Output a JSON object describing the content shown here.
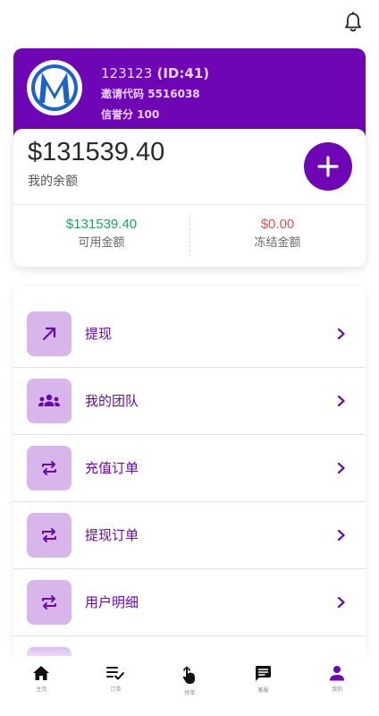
{
  "header": {
    "bell_icon": "bell-icon"
  },
  "profile": {
    "username": "123123",
    "id_text": "(ID:41)",
    "invite_label": "邀请代码",
    "invite_code": "5516038",
    "credit_label": "信誉分",
    "credit_score": "100",
    "avatar_letter": "M"
  },
  "balance": {
    "amount": "$131539.40",
    "label": "我的余额",
    "available_value": "$131539.40",
    "available_label": "可用金额",
    "frozen_value": "$0.00",
    "frozen_label": "冻结金额"
  },
  "menu": {
    "items": [
      {
        "label": "提现",
        "icon": "arrow-up-right-icon"
      },
      {
        "label": "我的团队",
        "icon": "team-icon"
      },
      {
        "label": "充值订单",
        "icon": "swap-icon"
      },
      {
        "label": "提现订单",
        "icon": "swap-icon"
      },
      {
        "label": "用户明细",
        "icon": "swap-icon"
      }
    ]
  },
  "nav": {
    "items": [
      {
        "label": "主页",
        "icon": "home-icon"
      },
      {
        "label": "订单",
        "icon": "orders-icon"
      },
      {
        "label": "抢单",
        "icon": "tap-icon"
      },
      {
        "label": "客服",
        "icon": "chat-icon"
      },
      {
        "label": "我的",
        "icon": "person-icon"
      }
    ]
  },
  "colors": {
    "primary": "#6f06b6",
    "icon_bg": "#d8b6ec",
    "available": "#18a860",
    "frozen": "#e2534c"
  }
}
